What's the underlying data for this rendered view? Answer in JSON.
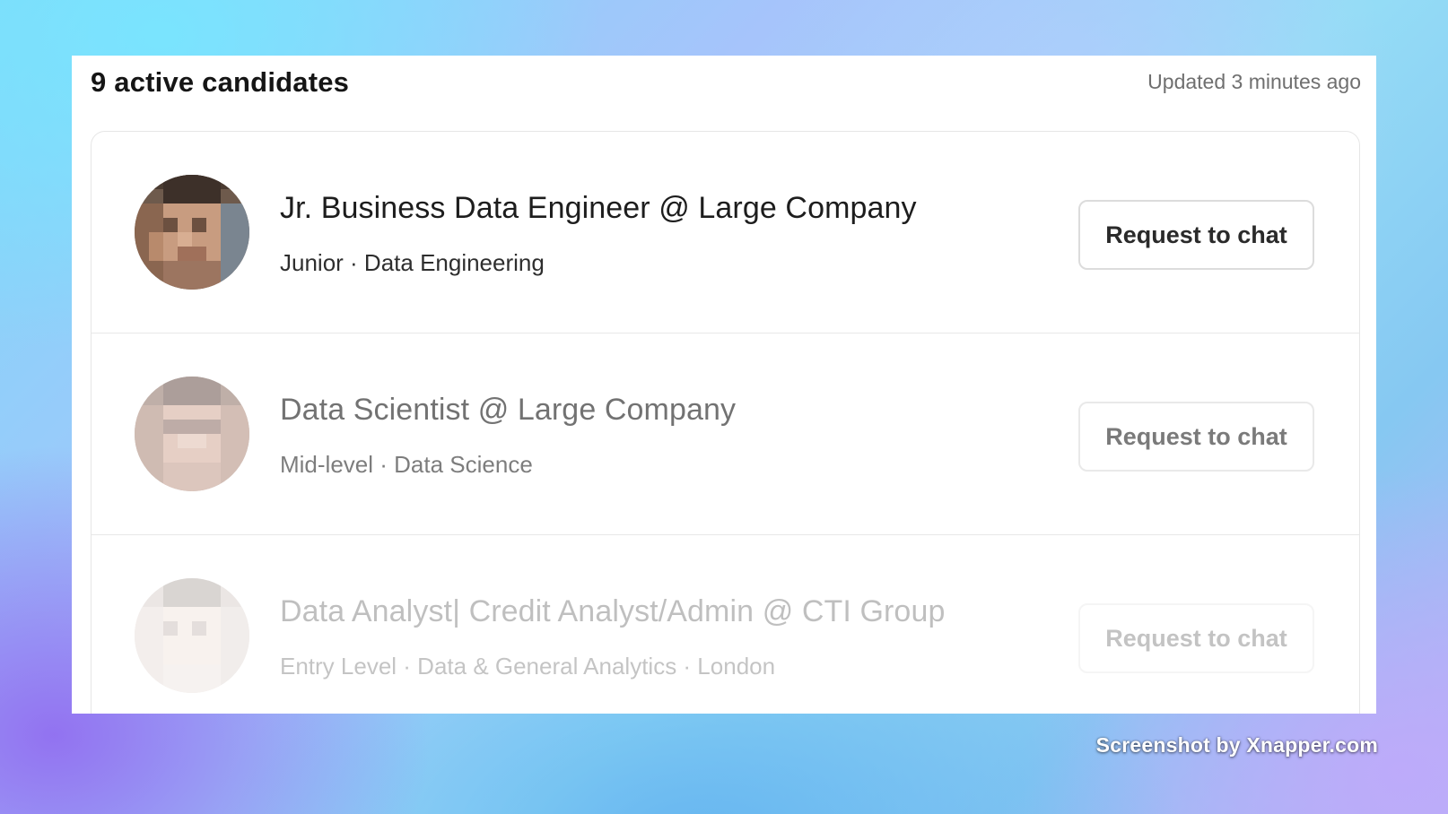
{
  "header": {
    "title": "9 active candidates",
    "updated": "Updated 3 minutes ago"
  },
  "candidates": [
    {
      "title": "Jr. Business Data Engineer @ Large Company",
      "meta": "Junior · Data Engineering",
      "button_label": "Request to chat"
    },
    {
      "title": "Data Scientist @ Large Company",
      "meta": "Mid-level · Data Science",
      "button_label": "Request to chat"
    },
    {
      "title": "Data Analyst| Credit Analyst/Admin @ CTI Group",
      "meta": "Entry Level · Data & General Analytics · London",
      "button_label": "Request to chat"
    }
  ],
  "watermark": "Screenshot by Xnapper.com",
  "colors": {
    "card_background": "#ffffff",
    "text_primary": "#1d1d1d",
    "text_secondary": "#6f6f6f",
    "border": "#e6e6e6"
  }
}
